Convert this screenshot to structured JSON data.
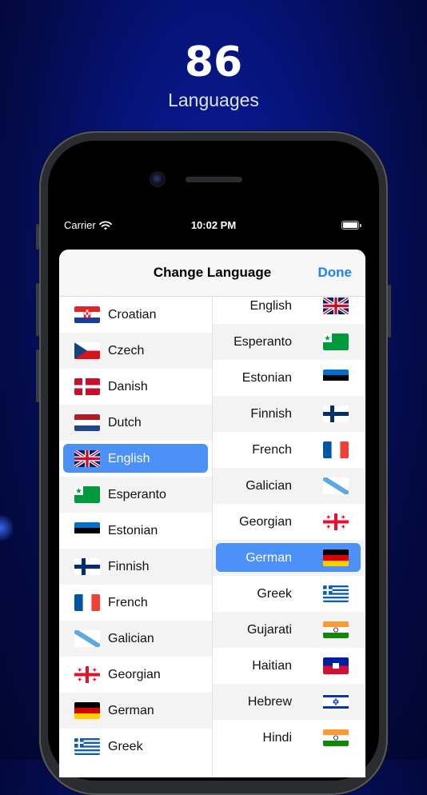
{
  "promo": {
    "count": "86",
    "subtitle": "Languages"
  },
  "status_bar": {
    "carrier": "Carrier",
    "time": "10:02 PM"
  },
  "sheet": {
    "title": "Change Language",
    "done_label": "Done"
  },
  "left_list": {
    "selected": "English",
    "items": [
      {
        "label": "Croatian",
        "flag": "croatia-flag"
      },
      {
        "label": "Czech",
        "flag": "czech-flag"
      },
      {
        "label": "Danish",
        "flag": "denmark-flag"
      },
      {
        "label": "Dutch",
        "flag": "netherlands-flag"
      },
      {
        "label": "English",
        "flag": "uk-flag"
      },
      {
        "label": "Esperanto",
        "flag": "esperanto-flag"
      },
      {
        "label": "Estonian",
        "flag": "estonia-flag"
      },
      {
        "label": "Finnish",
        "flag": "finland-flag"
      },
      {
        "label": "French",
        "flag": "france-flag"
      },
      {
        "label": "Galician",
        "flag": "galicia-flag"
      },
      {
        "label": "Georgian",
        "flag": "georgia-flag"
      },
      {
        "label": "German",
        "flag": "germany-flag"
      },
      {
        "label": "Greek",
        "flag": "greece-flag"
      }
    ]
  },
  "right_list": {
    "selected": "German",
    "items": [
      {
        "label": "English",
        "flag": "uk-flag"
      },
      {
        "label": "Esperanto",
        "flag": "esperanto-flag"
      },
      {
        "label": "Estonian",
        "flag": "estonia-flag"
      },
      {
        "label": "Finnish",
        "flag": "finland-flag"
      },
      {
        "label": "French",
        "flag": "france-flag"
      },
      {
        "label": "Galician",
        "flag": "galicia-flag"
      },
      {
        "label": "Georgian",
        "flag": "georgia-flag"
      },
      {
        "label": "German",
        "flag": "germany-flag"
      },
      {
        "label": "Greek",
        "flag": "greece-flag"
      },
      {
        "label": "Gujarati",
        "flag": "india-flag"
      },
      {
        "label": "Haitian",
        "flag": "haiti-flag"
      },
      {
        "label": "Hebrew",
        "flag": "israel-flag"
      },
      {
        "label": "Hindi",
        "flag": "india-flag"
      }
    ]
  },
  "colors": {
    "accent": "#1a82f7",
    "selection": "#4b91f7",
    "background": "#06137a"
  }
}
